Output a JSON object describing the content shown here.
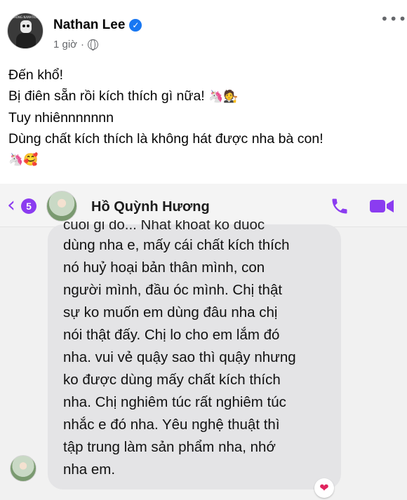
{
  "post": {
    "author": "Nathan Lee",
    "verified_glyph": "✓",
    "time": "1 giờ",
    "separator": "·",
    "privacy_icon": "globe-icon",
    "more_label": "•••",
    "avatar_caption": "KHÔNG NAMATION",
    "lines": [
      "Đến khổ!",
      "Bị điên sẵn rồi kích thích gì nữa!",
      "Tuy nhiênnnnnnn",
      "Dùng chất kích thích là không hát được nha bà con!"
    ],
    "emojis_line2": "🦄🧑‍⚖️",
    "emojis_line5": "🦄🥰"
  },
  "messenger": {
    "unread_count": "5",
    "contact_name": "Hồ Quỳnh Hương",
    "accent_color": "#8b3cf0",
    "message_lines": [
      "cuoi gi do... Nhat khoat ko duoc",
      "dùng nha e, mấy cái chất kích thích",
      "nó huỷ hoại bản thân mình, con",
      "người mình, đầu óc mình. Chị thật",
      "sự ko muốn em dùng đâu nha chị",
      "nói thật đấy. Chị lo cho em lắm đó",
      "nha. vui vẻ quậy sao thì quậy nhưng",
      "ko được dùng mấy chất kích thích",
      "nha. Chị nghiêm túc rất nghiêm túc",
      "nhắc e đó nha. Yêu nghệ thuật thì",
      "tập trung làm sản phẩm nha, nhớ",
      "nha em."
    ],
    "reaction": "❤"
  }
}
